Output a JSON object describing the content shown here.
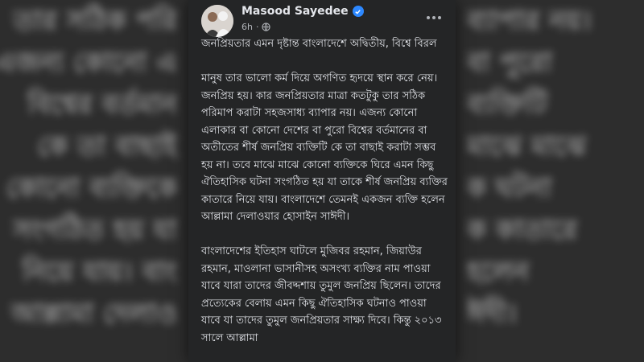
{
  "post": {
    "author": "Masood Sayedee",
    "time": "6h",
    "paragraphs": [
      "জনপ্রিয়তার এমন দৃষ্টান্ত বাংলাদেশে অদ্বিতীয়, বিশ্বে বিরল",
      "মানুষ তার ভালো কর্ম দিয়ে অগণিত হৃদয়ে স্থান করে নেয়। জনপ্রিয় হয়। কার জনপ্রিয়তার মাত্রা কতটুকু তার সঠিক পরিমাপ করাটা সহজসাধ্য ব্যাপার নয়। এজন্য কোনো এলাকার বা কোনো দেশের বা পুরো বিশ্বের বর্তমানের বা অতীতের শীর্ষ জনপ্রিয় ব্যক্তিটি কে তা বাছাই করাটা সম্ভব হয় না। তবে মাঝে মাঝে কোনো ব্যক্তিকে ঘিরে এমন কিছু ঐতিহাসিক ঘটনা সংগঠিত হয় যা তাকে শীর্ষ জনপ্রিয় ব্যক্তির কাতারে নিয়ে যায়। বাংলাদেশে তেমনই একজন ব্যক্তি হলেন আল্লামা দেলাওয়ার হোসাইন সাঈদী।",
      "বাংলাদেশের ইতিহাস ঘাটলে মুজিবর রহমান, জিয়াউর রহমান, মাওলানা ভাসানীসহ অসংখ্য ব্যক্তির নাম পাওয়া যাবে যারা তাদের জীবদ্দশায় তুমুল জনপ্রিয় ছিলেন। তাদের প্রত্যেকের বেলায় এমন কিছু ঐতিহাসিক ঘটনাও পাওয়া যাবে যা তাদের তুমুল জনপ্রিয়তার সাক্ষ্য দিবে। কিন্তু ২০১৩ সালে আল্লামা"
    ]
  },
  "background": {
    "left_lines": [
      "তার সঠিক পরি",
      "এজন্য কোনো এ",
      "বিশ্বের বর্তমান",
      "কে তা বাছাই",
      "কোনো ব্যক্তিকে",
      "সংগঠিত হয় যা",
      "নিয়ে যায়। বাং",
      "আল্লামা দেলাও"
    ],
    "right_lines": [
      "ব্যাপার নয়।",
      "বা পুরো",
      "ব্যক্তিটি",
      "মাঝে মাঝে",
      "ক ঘটনা",
      "ক কাতারে",
      "হলেন",
      "ঈদী।"
    ]
  }
}
